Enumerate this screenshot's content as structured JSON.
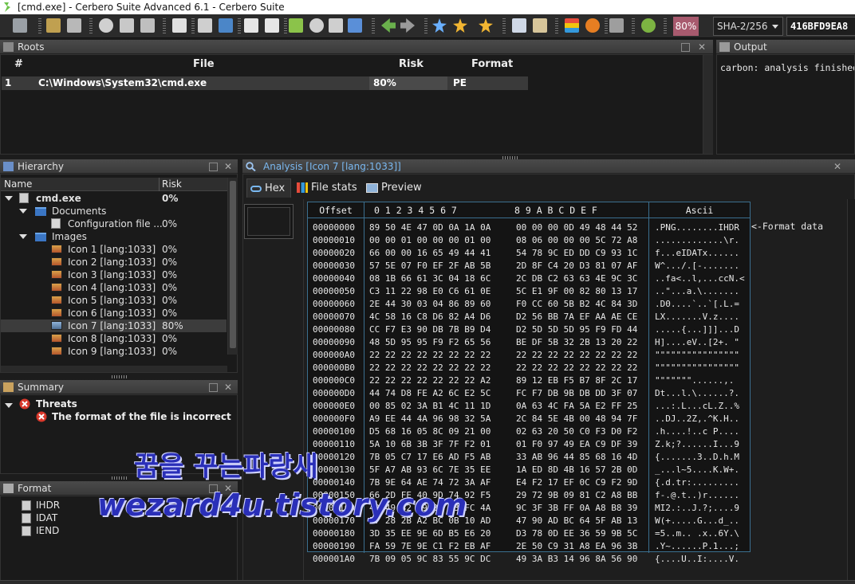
{
  "window": {
    "title": "[cmd.exe] - Cerbero Suite Advanced 6.1 - Cerbero Suite"
  },
  "toolbar": {
    "risk_percent": "80%",
    "hash_algorithm": "SHA-2/256",
    "hash_value": "416BFD9EA8",
    "colors": {
      "risk_bg": "#a85a6e"
    }
  },
  "roots": {
    "title": "Roots",
    "columns": [
      "#",
      "File",
      "Risk",
      "Format"
    ],
    "rows": [
      {
        "num": "1",
        "file": "C:\\Windows\\System32\\cmd.exe",
        "risk": "80%",
        "format": "PE"
      }
    ]
  },
  "output": {
    "title": "Output",
    "text": "carbon: analysis finished"
  },
  "hierarchy": {
    "title": "Hierarchy",
    "columns": [
      "Name",
      "Risk"
    ],
    "nodes": [
      {
        "label": "cmd.exe",
        "risk": "0%",
        "icon": "file-icon",
        "bold": true
      },
      {
        "label": "Documents",
        "risk": "",
        "icon": "folder-icon"
      },
      {
        "label": "Configuration file ...",
        "risk": "0%",
        "icon": "file-icon"
      },
      {
        "label": "Images",
        "risk": "",
        "icon": "folder-icon"
      },
      {
        "label": "Icon 1 [lang:1033]",
        "risk": "0%",
        "icon": "image-icon"
      },
      {
        "label": "Icon 2 [lang:1033]",
        "risk": "0%",
        "icon": "image-icon"
      },
      {
        "label": "Icon 3 [lang:1033]",
        "risk": "0%",
        "icon": "image-icon"
      },
      {
        "label": "Icon 4 [lang:1033]",
        "risk": "0%",
        "icon": "image-icon"
      },
      {
        "label": "Icon 5 [lang:1033]",
        "risk": "0%",
        "icon": "image-icon"
      },
      {
        "label": "Icon 6 [lang:1033]",
        "risk": "0%",
        "icon": "image-icon"
      },
      {
        "label": "Icon 7 [lang:1033]",
        "risk": "80%",
        "icon": "image-icon",
        "selected": true
      },
      {
        "label": "Icon 8 [lang:1033]",
        "risk": "0%",
        "icon": "image-icon"
      },
      {
        "label": "Icon 9 [lang:1033]",
        "risk": "0%",
        "icon": "image-icon"
      }
    ]
  },
  "summary": {
    "title": "Summary",
    "group": "Threats",
    "items": [
      "The format of the file is incorrect"
    ]
  },
  "format": {
    "title": "Format",
    "items": [
      "IHDR",
      "IDAT",
      "IEND"
    ]
  },
  "analysis": {
    "title": "Analysis [Icon 7 [lang:1033]]",
    "tabs": [
      "Hex",
      "File stats",
      "Preview"
    ],
    "hex": {
      "header_offset": "Offset",
      "header_bytes_left": "0  1  2  3  4  5  6  7",
      "header_bytes_right": "8  9  A  B  C  D  E  F",
      "header_ascii": "Ascii",
      "annotation": "<-Format data",
      "rows": [
        {
          "off": "00000000",
          "l": "89 50 4E 47 0D 0A 1A 0A",
          "r": "00 00 00 0D 49 48 44 52",
          "a": ".PNG........IHDR"
        },
        {
          "off": "00000010",
          "l": "00 00 01 00 00 00 01 00",
          "r": "08 06 00 00 00 5C 72 A8",
          "a": ".............\\r."
        },
        {
          "off": "00000020",
          "l": "66 00 00 16 65 49 44 41",
          "r": "54 78 9C ED DD C9 93 1C",
          "a": "f...eIDATx......"
        },
        {
          "off": "00000030",
          "l": "57 5E 07 F0 EF 2F AB 5B",
          "r": "2D 8F C4 20 D3 81 07 AF",
          "a": "W^.../.[-......."
        },
        {
          "off": "00000040",
          "l": "08 1B 66 61 3C 04 18 6C",
          "r": "2C DB C2 63 63 4E 9C 3C",
          "a": "..fa<..l,...ccN.<"
        },
        {
          "off": "00000050",
          "l": "C3 11 22 98 E0 C6 61 0E",
          "r": "5C E1 9F 00 82 80 13 17",
          "a": "..\"...a.\\......."
        },
        {
          "off": "00000060",
          "l": "2E 44 30 03 04 86 89 60",
          "r": "F0 CC 60 5B B2 4C 84 3D",
          "a": ".D0....`..`[.L.="
        },
        {
          "off": "00000070",
          "l": "4C 58 16 C8 D6 82 A4 D6",
          "r": "D2 56 BB 7A EF AA AE CE",
          "a": "LX.......V.z...."
        },
        {
          "off": "00000080",
          "l": "CC F7 E3 90 DB 7B B9 D4",
          "r": "D2 5D 5D 5D 95 F9 FD 44",
          "a": ".....{...]]]...D"
        },
        {
          "off": "00000090",
          "l": "48 5D 95 95 F9 F2 65 56",
          "r": "BE DF 5B 32 2B 13 20 22",
          "a": "H]....eV..[2+. \""
        },
        {
          "off": "000000A0",
          "l": "22 22 22 22 22 22 22 22",
          "r": "22 22 22 22 22 22 22 22",
          "a": "\"\"\"\"\"\"\"\"\"\"\"\"\"\"\"\""
        },
        {
          "off": "000000B0",
          "l": "22 22 22 22 22 22 22 22",
          "r": "22 22 22 22 22 22 22 22",
          "a": "\"\"\"\"\"\"\"\"\"\"\"\"\"\"\"\""
        },
        {
          "off": "000000C0",
          "l": "22 22 22 22 22 22 22 A2",
          "r": "89 12 EB F5 B7 8F 2C 17",
          "a": "\"\"\"\"\"\"\"......,."
        },
        {
          "off": "000000D0",
          "l": "44 74 D8 FE A2 6C E2 5C",
          "r": "FC F7 DB 9B DB DD 3F 07",
          "a": "Dt...l.\\......?."
        },
        {
          "off": "000000E0",
          "l": "00 85 02 3A B1 4C 11 1D",
          "r": "0A 63 4C FA 5A E2 FF 25",
          "a": "...:.L...cL.Z..%"
        },
        {
          "off": "000000F0",
          "l": "A9 EE 44 4A 96 98 32 5A",
          "r": "2C 84 5E 4B 00 48 94 7F",
          "a": "..DJ..2Z,.^K.H.."
        },
        {
          "off": "00000100",
          "l": "D5 68 16 05 8C 09 21 00",
          "r": "02 63 20 50 C0 F3 D0 F2",
          "a": ".h....!..c P...."
        },
        {
          "off": "00000110",
          "l": "5A 10 6B 3B 3F 7F F2 01",
          "r": "01 F0 97 49 EA C9 DF 39",
          "a": "Z.k;?......I...9"
        },
        {
          "off": "00000120",
          "l": "7B 05 C7 17 E6 AD F5 AB",
          "r": "33 AB 96 44 85 68 16 4D",
          "a": "{.......3..D.h.M"
        },
        {
          "off": "00000130",
          "l": "5F A7 AB 93 6C 7E 35 EE",
          "r": "1A ED 8D 4B 16 57 2B 0D",
          "a": "_...l~5....K.W+."
        },
        {
          "off": "00000140",
          "l": "7B 9E 64 AE 74 72 3A AF",
          "r": "E4 F2 17 EF 0C C9 F2 9D",
          "a": "{.d.tr:........."
        },
        {
          "off": "00000150",
          "l": "66 2D FE 40 9D 74 92 F5",
          "r": "29 72 9B 09 81 C2 A8 BB",
          "a": "f-.@.t..)r......"
        },
        {
          "off": "00000160",
          "l": "4D 49 32 E9 3A D3 FC 4A",
          "r": "9C 3F 3B FF 0A A8 B8 39",
          "a": "MI2.:..J.?;....9"
        },
        {
          "off": "00000170",
          "l": "57 28 2B A2 BC 0B 10 AD",
          "r": "47 90 AD BC 64 5F AB 13",
          "a": "W(+.....G...d_.."
        },
        {
          "off": "00000180",
          "l": "3D 35 EE 9E 6D B5 E6 20",
          "r": "D3 78 0D EE 36 59 9B 5C",
          "a": "=5..m.. .x..6Y.\\"
        },
        {
          "off": "00000190",
          "l": "FA 59 7E 9E C1 F2 EB AF",
          "r": "2E 50 C9 31 A8 EA 96 3B",
          "a": ".Y~......P.1...;"
        },
        {
          "off": "000001A0",
          "l": "7B 09 05 9C 83 55 9C DC",
          "r": "49 3A B3 14 96 8A 56 90",
          "a": "{....U..I:....V."
        }
      ]
    }
  },
  "watermark": {
    "korean": "꿈을 꾸는파랑새",
    "url": "wezard4u.tistory.com"
  }
}
